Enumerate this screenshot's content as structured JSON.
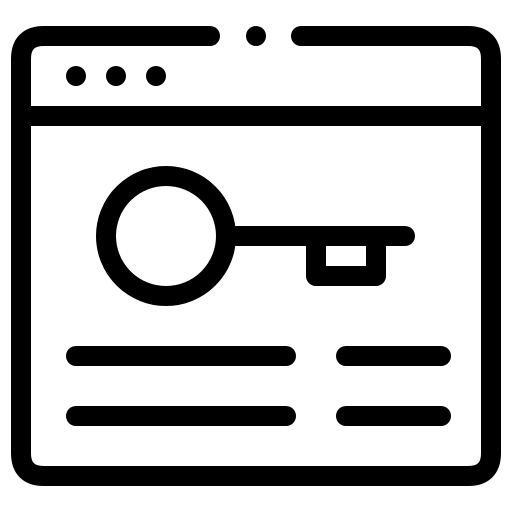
{
  "icon": {
    "name": "browser-window-key-icon",
    "stroke_color": "#000000",
    "background_color": "#ffffff",
    "window_dots": 3,
    "text_lines": 4,
    "key_icon": "key-icon"
  }
}
